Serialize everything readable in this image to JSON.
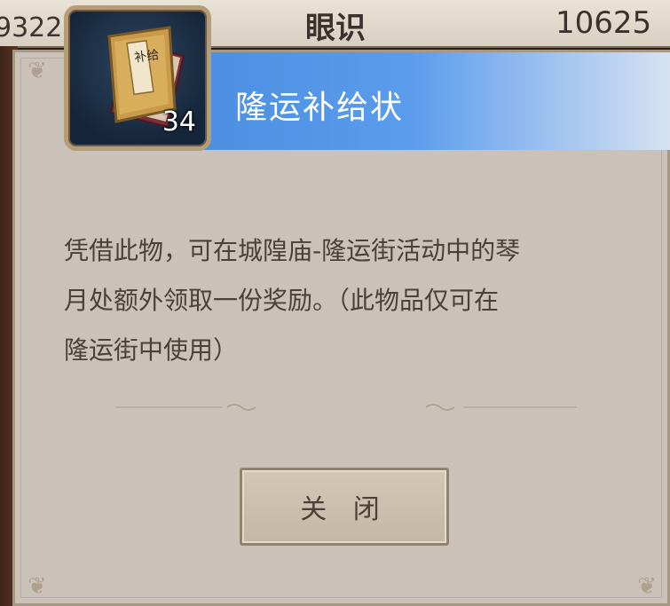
{
  "background": {
    "left_number": "9322",
    "title": "眼识",
    "right_number": "10625"
  },
  "dialog": {
    "title": "隆运补给状",
    "item": {
      "name": "item-scroll-icon",
      "count": "34",
      "label": "补给"
    },
    "description_lines": [
      "凭借此物，可在城隍庙-隆运街活动中的琴",
      "月处额外领取一份奖励。（此物品仅可在",
      "隆运街中使用）"
    ],
    "close_label": "关 闭"
  },
  "colors": {
    "banner_start": "#4c8fe0",
    "dialog_bg": "#cac1b9",
    "text": "#4a4036"
  }
}
